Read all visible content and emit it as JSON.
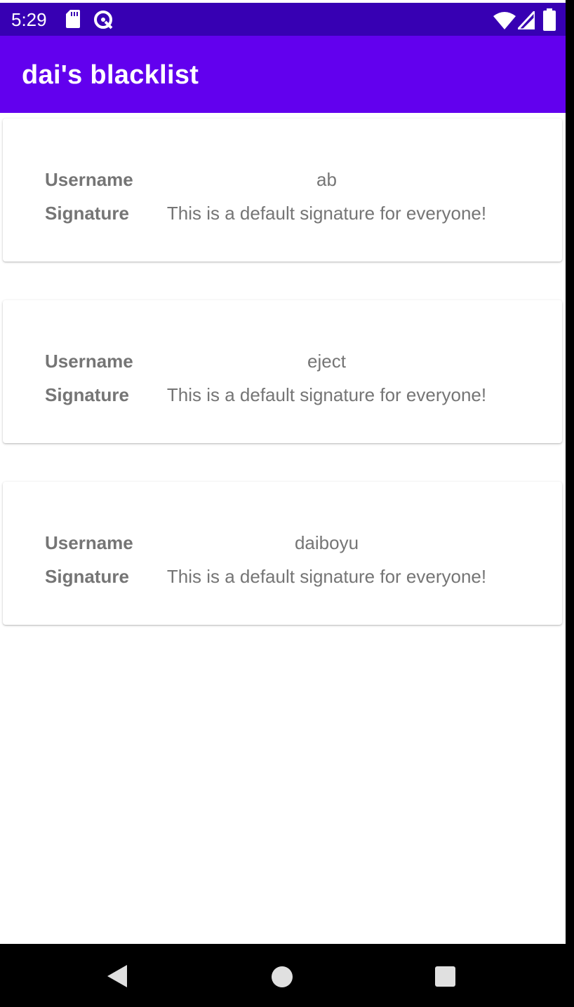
{
  "status_bar": {
    "time": "5:29",
    "left_icons": [
      "sd-card-icon",
      "data-saver-icon"
    ],
    "right_icons": [
      "wifi-icon",
      "cellular-signal-icon",
      "battery-icon"
    ]
  },
  "app_bar": {
    "title": "dai's blacklist"
  },
  "blacklist": {
    "items": [
      {
        "username_label": "Username",
        "username": "ab",
        "signature_label": "Signature",
        "signature": "This is a default signature for everyone!"
      },
      {
        "username_label": "Username",
        "username": "eject",
        "signature_label": "Signature",
        "signature": "This is a default signature for everyone!"
      },
      {
        "username_label": "Username",
        "username": "daiboyu",
        "signature_label": "Signature",
        "signature": "This is a default signature for everyone!"
      }
    ]
  },
  "nav_bar": {
    "buttons": [
      "back-icon",
      "home-icon",
      "recents-icon"
    ]
  },
  "colors": {
    "status_bar": "#3700b3",
    "app_bar": "#6200ee",
    "text_secondary": "#757575",
    "background": "#ffffff"
  }
}
